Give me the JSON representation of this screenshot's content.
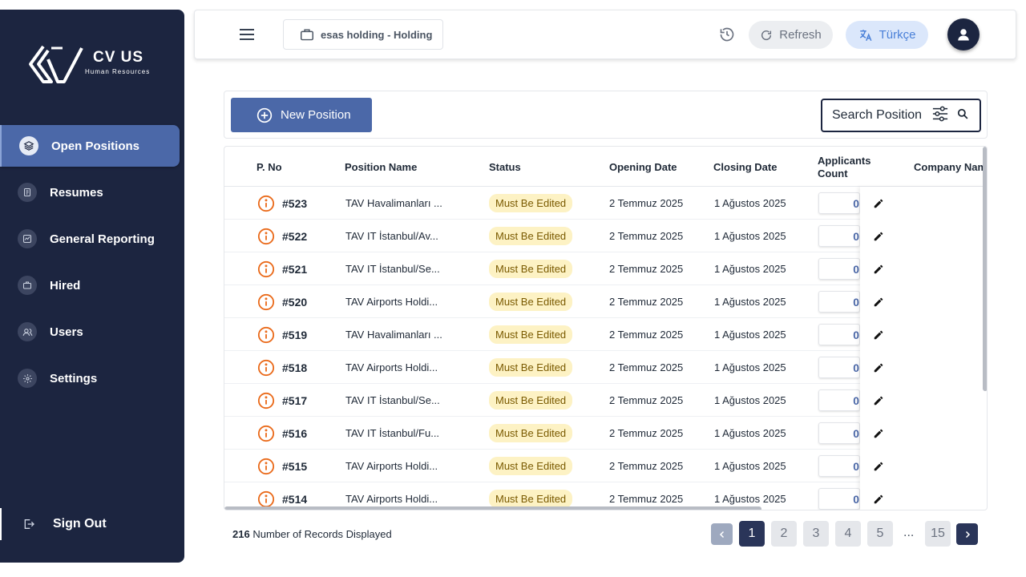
{
  "brand": {
    "name": "CV US",
    "tagline": "Human Resources"
  },
  "sidebar": {
    "items": [
      {
        "label": "Open Positions",
        "icon": "layers-icon",
        "active": true
      },
      {
        "label": "Resumes",
        "icon": "document-icon"
      },
      {
        "label": "General Reporting",
        "icon": "chart-icon"
      },
      {
        "label": "Hired",
        "icon": "briefcase-icon"
      },
      {
        "label": "Users",
        "icon": "users-icon"
      },
      {
        "label": "Settings",
        "icon": "gear-icon"
      }
    ],
    "signout_label": "Sign Out"
  },
  "header": {
    "company": "esas holding - Holding",
    "refresh_label": "Refresh",
    "language_label": "Türkçe"
  },
  "toolbar": {
    "new_position_label": "New Position",
    "search_placeholder": "Search Position"
  },
  "table": {
    "columns": {
      "pno": "P. No",
      "position_name": "Position Name",
      "status": "Status",
      "opening_date": "Opening Date",
      "closing_date": "Closing Date",
      "applicants_count": "Applicants Count",
      "company_name": "Company Nam"
    },
    "rows": [
      {
        "pno": "#523",
        "name": "TAV Havalimanları ...",
        "status": "Must Be Edited",
        "opening": "2 Temmuz 2025",
        "closing": "1 Ağustos 2025",
        "count": "0"
      },
      {
        "pno": "#522",
        "name": "TAV IT İstanbul/Av...",
        "status": "Must Be Edited",
        "opening": "2 Temmuz 2025",
        "closing": "1 Ağustos 2025",
        "count": "0"
      },
      {
        "pno": "#521",
        "name": "TAV IT İstanbul/Se...",
        "status": "Must Be Edited",
        "opening": "2 Temmuz 2025",
        "closing": "1 Ağustos 2025",
        "count": "0"
      },
      {
        "pno": "#520",
        "name": "TAV Airports Holdi...",
        "status": "Must Be Edited",
        "opening": "2 Temmuz 2025",
        "closing": "1 Ağustos 2025",
        "count": "0"
      },
      {
        "pno": "#519",
        "name": "TAV Havalimanları ...",
        "status": "Must Be Edited",
        "opening": "2 Temmuz 2025",
        "closing": "1 Ağustos 2025",
        "count": "0"
      },
      {
        "pno": "#518",
        "name": "TAV Airports Holdi...",
        "status": "Must Be Edited",
        "opening": "2 Temmuz 2025",
        "closing": "1 Ağustos 2025",
        "count": "0"
      },
      {
        "pno": "#517",
        "name": "TAV IT İstanbul/Se...",
        "status": "Must Be Edited",
        "opening": "2 Temmuz 2025",
        "closing": "1 Ağustos 2025",
        "count": "0"
      },
      {
        "pno": "#516",
        "name": "TAV IT İstanbul/Fu...",
        "status": "Must Be Edited",
        "opening": "2 Temmuz 2025",
        "closing": "1 Ağustos 2025",
        "count": "0"
      },
      {
        "pno": "#515",
        "name": "TAV Airports Holdi...",
        "status": "Must Be Edited",
        "opening": "2 Temmuz 2025",
        "closing": "1 Ağustos 2025",
        "count": "0"
      },
      {
        "pno": "#514",
        "name": "TAV Airports Holdi...",
        "status": "Must Be Edited",
        "opening": "2 Temmuz 2025",
        "closing": "1 Ağustos 2025",
        "count": "0"
      }
    ]
  },
  "footer": {
    "record_count": "216",
    "record_label": "Number of Records Displayed"
  },
  "pagination": {
    "pages": [
      "1",
      "2",
      "3",
      "4",
      "5"
    ],
    "ellipsis": "...",
    "last_page": "15",
    "current": "1"
  },
  "colors": {
    "sidebar_bg": "#1c2540",
    "accent": "#4b68a8",
    "status_badge_bg": "#fdf2c4",
    "info_icon": "#ea6a1a"
  }
}
